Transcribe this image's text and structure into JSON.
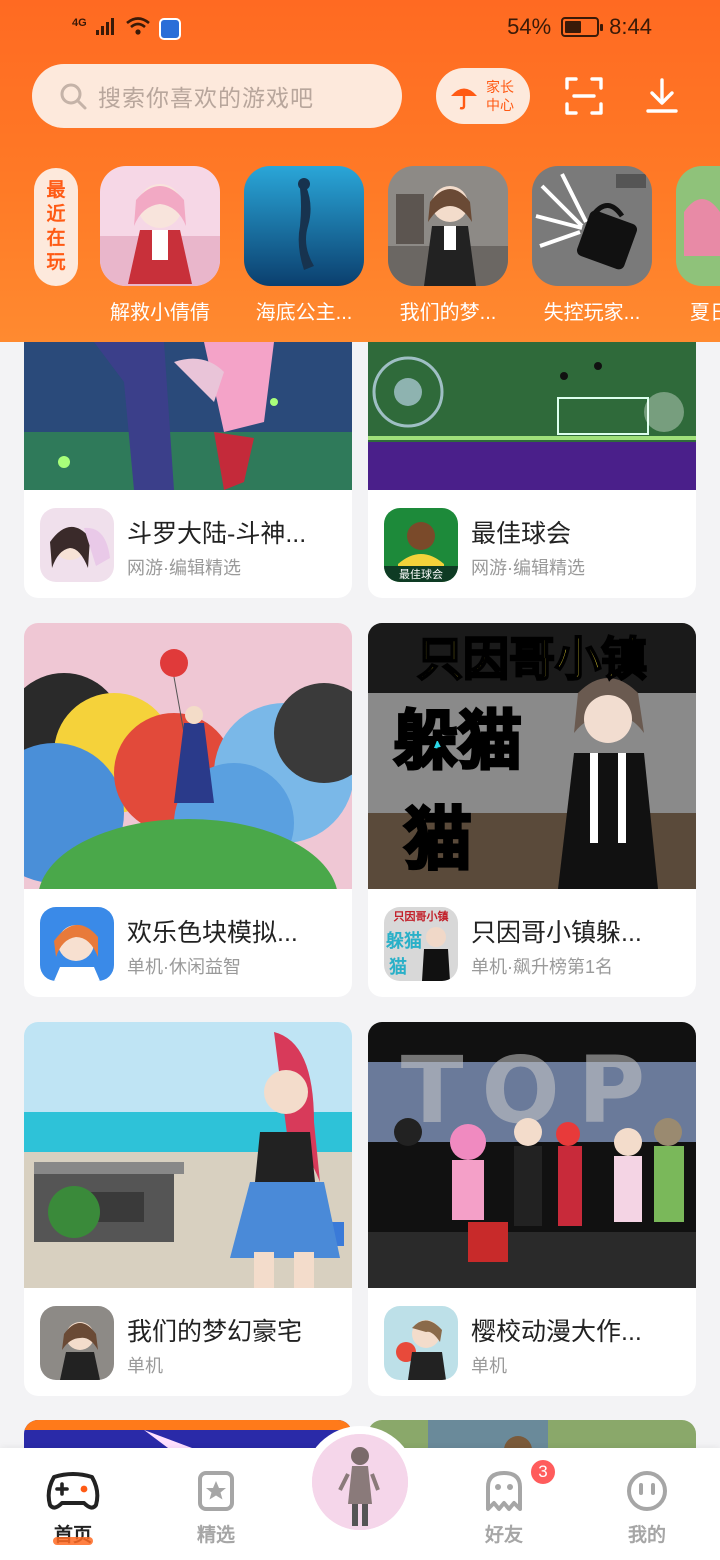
{
  "status_bar": {
    "network": "4G",
    "battery_text": "54%",
    "battery_level": 0.54,
    "time": "8:44"
  },
  "header": {
    "search_placeholder": "搜索你喜欢的游戏吧",
    "parent_center_line1": "家长",
    "parent_center_line2": "中心",
    "recent_tag": "最近在玩",
    "recent_games": [
      {
        "name": "解救小倩倩",
        "icon": "anime-girl-thumb"
      },
      {
        "name": "海底公主...",
        "icon": "mermaid-thumb"
      },
      {
        "name": "我们的梦...",
        "icon": "girl-peace-thumb"
      },
      {
        "name": "失控玩家...",
        "icon": "bag-thumb"
      },
      {
        "name": "夏日",
        "icon": "partial-thumb"
      }
    ]
  },
  "feed": [
    {
      "title": "斗罗大陆-斗神...",
      "subtitle": "网游·编辑精选"
    },
    {
      "title": "最佳球会",
      "subtitle": "网游·编辑精选"
    },
    {
      "title": "欢乐色块模拟...",
      "subtitle": "单机·休闲益智"
    },
    {
      "title": "只因哥小镇躲...",
      "subtitle": "单机·飙升榜第1名",
      "banner_line1": "只因哥小镇",
      "banner_line2": "躲猫",
      "banner_line3": "猫",
      "icon_text1": "只因哥小镇",
      "icon_text2": "躲猫",
      "icon_text3": "猫"
    },
    {
      "title": "我们的梦幻豪宅",
      "subtitle": "单机"
    },
    {
      "title": "樱校动漫大作...",
      "subtitle": "单机",
      "banner_text": "TOP"
    }
  ],
  "card1_icon_text": "最佳球会",
  "bottom_nav": [
    {
      "label": "首页",
      "active": true
    },
    {
      "label": "精选",
      "active": false
    },
    {
      "label": "好友",
      "active": false,
      "badge": "3"
    },
    {
      "label": "我的",
      "active": false
    }
  ],
  "colors": {
    "brand": "#ff6a22",
    "badge": "#ff5c5c"
  }
}
